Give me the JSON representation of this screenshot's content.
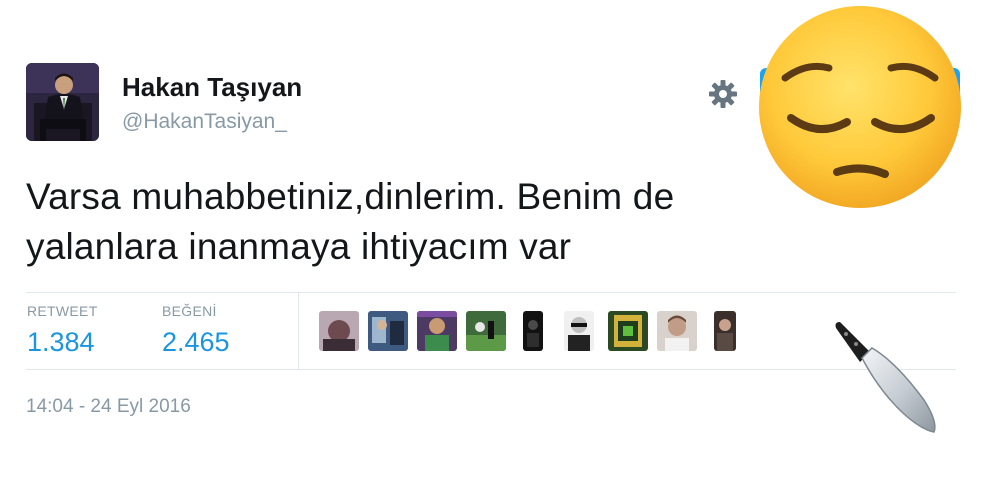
{
  "user": {
    "display_name": "Hakan Taşıyan",
    "username": "@HakanTasiyan_"
  },
  "tweet": {
    "text_line1": "Varsa muhabbetiniz,dinlerim. Benim de",
    "text_line2": "yalanlara inanmaya ihtiyacım var"
  },
  "stats": {
    "retweet_label": "RETWEET",
    "retweet_value": "1.384",
    "like_label": "BEĞENİ",
    "like_value": "2.465"
  },
  "likers_count_shown": 9,
  "timestamp": "14:04 - 24 Eyl 2016",
  "icons": {
    "settings": "gear-icon",
    "overlay_emoji_1": "pensive-face-emoji",
    "overlay_emoji_2": "knife-emoji"
  },
  "colors": {
    "link_blue": "#1b95e0",
    "muted_gray": "#8899a6",
    "text": "#14171a",
    "divider": "#e1e8ed",
    "brand_blue": "#1da1f2"
  }
}
